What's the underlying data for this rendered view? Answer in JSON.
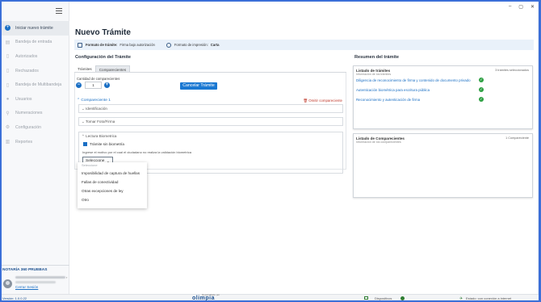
{
  "window": {
    "controls": [
      "–",
      "▢",
      "✕"
    ]
  },
  "sidebar": {
    "items": [
      {
        "label": "Iniciar nuevo trámite",
        "icon": "plus-circle-icon",
        "active": true
      },
      {
        "label": "Bandeja de entrada",
        "icon": "inbox-icon"
      },
      {
        "label": "Autorizados",
        "icon": "document-check-icon"
      },
      {
        "label": "Rechazados",
        "icon": "document-x-icon"
      },
      {
        "label": "Bandeja de Multibandeja",
        "icon": "document-stack-icon"
      },
      {
        "label": "Usuarios",
        "icon": "user-icon"
      },
      {
        "label": "Numeraciones",
        "icon": "numbering-icon"
      },
      {
        "label": "Configuración",
        "icon": "gear-icon"
      },
      {
        "label": "Reportes",
        "icon": "chart-icon"
      }
    ],
    "notary_name": "NOTARÍA 360 PRUEBAS",
    "logout": "Cerrar Sesión"
  },
  "main": {
    "title": "Nuevo Trámite",
    "info": {
      "format_label": "Formato de trámite:",
      "format_value": "Firma bajo autorización",
      "print_label": "Formato de impresión:",
      "print_value": "Carta"
    },
    "config_title": "Configuración del Trámite",
    "tabs": [
      "Trámites",
      "Comparecientes"
    ],
    "qty_label": "Cantidad de comparecientes",
    "qty_value": "1",
    "cancel_button": "Cancelar Trámite",
    "compareciente": "Compareciente 1",
    "delete": "Omitir compareciente",
    "sections": [
      "Identificación",
      "Tomar Foto/Firma",
      "Lectura Biometrica"
    ],
    "biometric_checkbox": "Trámite sin biometría",
    "reason_label": "Ingrese el motivo por el cual el ciudadano no realiza la validación biometrica",
    "select_value": "Seleccione",
    "dropdown": {
      "placeholder": "Seleccione",
      "options": [
        "Imposibilidad de captura de huellas",
        "Fallas de conectividad",
        "Otras excepciones de ley",
        "Otro"
      ]
    }
  },
  "summary": {
    "title": "Resumen del trámite",
    "tramites_card": {
      "title": "Listado de trámites",
      "subtitle": "Información de los trámites",
      "count": "3 trámites seleccionados",
      "rows": [
        "Diligencia de reconocimiento de firma y contenido de documento privado",
        "Autenticación biométrica para escritura pública",
        "Reconocimiento y autenticación de firma"
      ]
    },
    "comparecientes_card": {
      "title": "Listado de Comparecientes",
      "subtitle": "Información de los comparecientes",
      "count": "1 Compareciente"
    }
  },
  "footer": {
    "version": "Versión: 1.0.0.22",
    "developed_by": "Desarrollado por",
    "brand": "olimpia",
    "devices": "Dispositivos",
    "network": "Estado: con conexión a internet"
  }
}
